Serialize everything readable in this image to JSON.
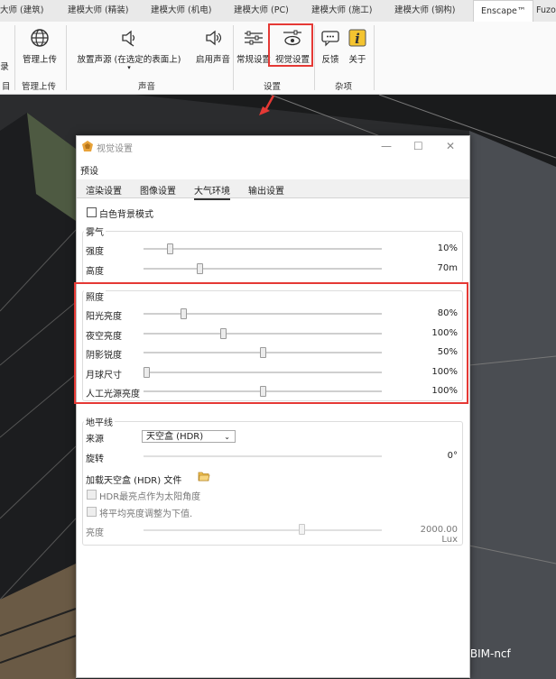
{
  "ribbon": {
    "tabs": [
      "大师 (建筑)",
      "建模大师 (精装)",
      "建模大师 (机电)",
      "建模大师 (PC)",
      "建模大师 (施工)",
      "建模大师 (钢构)",
      "Enscape™",
      "Fuzo"
    ],
    "buttons": {
      "left_stub": "录",
      "upload": "管理上传",
      "place_sound": "放置声源 (在选定的表面上)",
      "enable_sound": "启用声音",
      "general_settings": "常规设置",
      "visual_settings": "视觉设置",
      "feedback": "反馈",
      "about": "关于"
    },
    "groups": {
      "left_stub": "目",
      "upload": "管理上传",
      "sound": "声音",
      "settings": "设置",
      "misc": "杂项"
    }
  },
  "dialog": {
    "title": "视觉设置",
    "preset_label": "预设",
    "tabs": [
      "渲染设置",
      "图像设置",
      "大气环境",
      "输出设置"
    ],
    "white_bg_label": "白色背景模式",
    "fog": {
      "legend": "雾气",
      "rows": [
        {
          "label": "强度",
          "value": "10%",
          "level": 0.1
        },
        {
          "label": "高度",
          "value": "70m",
          "level": 0.23
        }
      ]
    },
    "illumination": {
      "legend": "照度",
      "rows": [
        {
          "label": "阳光亮度",
          "value": "80%",
          "level": 0.16
        },
        {
          "label": "夜空亮度",
          "value": "100%",
          "level": 0.33
        },
        {
          "label": "阴影锐度",
          "value": "50%",
          "level": 0.5
        },
        {
          "label": "月球尺寸",
          "value": "100%",
          "level": 0.0
        },
        {
          "label": "人工光源亮度",
          "value": "100%",
          "level": 0.5
        }
      ]
    },
    "horizon": {
      "legend": "地平线",
      "source_label": "来源",
      "source_value": "天空盒 (HDR)",
      "rotation_label": "旋转",
      "rotation_value": "0°",
      "load_label": "加载天空盒 (HDR) 文件",
      "hdr_sun_label": "HDR最亮点作为太阳角度",
      "avg_brightness_label": "将平均亮度调整为下值.",
      "brightness_label": "亮度",
      "brightness_value": "2000.00 Lux",
      "brightness_level": 0.67
    }
  },
  "watermark": "微信号: BIM-ncf",
  "colors": {
    "highlight": "#e53935",
    "dialog_bg": "#ffffff",
    "scene_bg": "#3a3b3d"
  }
}
